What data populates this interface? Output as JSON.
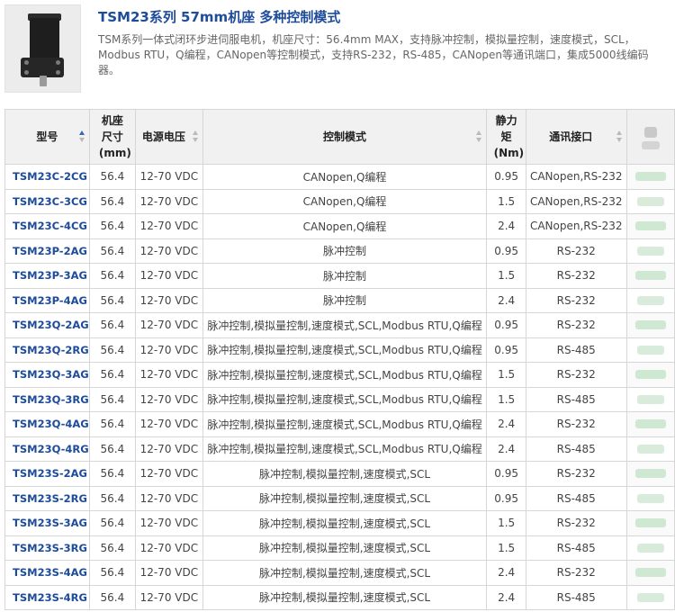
{
  "header": {
    "title": "TSM23系列 57mm机座 多种控制模式",
    "description": "TSM系列一体式闭环步进伺服电机，机座尺寸：56.4mm MAX，支持脉冲控制，模拟量控制，速度模式，SCL，Modbus RTU，Q编程，CANopen等控制模式，支持RS-232，RS-485，CANopen等通讯端口，集成5000线编码器。"
  },
  "table": {
    "columns": [
      {
        "label": "型号",
        "sort": "asc"
      },
      {
        "label": "机座尺寸(mm)",
        "sort": "none"
      },
      {
        "label": "电源电压",
        "sort": "none"
      },
      {
        "label": "控制模式",
        "sort": "none"
      },
      {
        "label": "静力矩(Nm)",
        "sort": "none"
      },
      {
        "label": "通讯接口",
        "sort": "none"
      }
    ],
    "rows": [
      {
        "model": "TSM23C-2CG",
        "frame": "56.4",
        "voltage": "12-70 VDC",
        "control": "CANopen,Q编程",
        "torque": "0.95",
        "comm": "CANopen,RS-232"
      },
      {
        "model": "TSM23C-3CG",
        "frame": "56.4",
        "voltage": "12-70 VDC",
        "control": "CANopen,Q编程",
        "torque": "1.5",
        "comm": "CANopen,RS-232"
      },
      {
        "model": "TSM23C-4CG",
        "frame": "56.4",
        "voltage": "12-70 VDC",
        "control": "CANopen,Q编程",
        "torque": "2.4",
        "comm": "CANopen,RS-232"
      },
      {
        "model": "TSM23P-2AG",
        "frame": "56.4",
        "voltage": "12-70 VDC",
        "control": "脉冲控制",
        "torque": "0.95",
        "comm": "RS-232"
      },
      {
        "model": "TSM23P-3AG",
        "frame": "56.4",
        "voltage": "12-70 VDC",
        "control": "脉冲控制",
        "torque": "1.5",
        "comm": "RS-232"
      },
      {
        "model": "TSM23P-4AG",
        "frame": "56.4",
        "voltage": "12-70 VDC",
        "control": "脉冲控制",
        "torque": "2.4",
        "comm": "RS-232"
      },
      {
        "model": "TSM23Q-2AG",
        "frame": "56.4",
        "voltage": "12-70 VDC",
        "control": "脉冲控制,模拟量控制,速度模式,SCL,Modbus RTU,Q编程",
        "torque": "0.95",
        "comm": "RS-232"
      },
      {
        "model": "TSM23Q-2RG",
        "frame": "56.4",
        "voltage": "12-70 VDC",
        "control": "脉冲控制,模拟量控制,速度模式,SCL,Modbus RTU,Q编程",
        "torque": "0.95",
        "comm": "RS-485"
      },
      {
        "model": "TSM23Q-3AG",
        "frame": "56.4",
        "voltage": "12-70 VDC",
        "control": "脉冲控制,模拟量控制,速度模式,SCL,Modbus RTU,Q编程",
        "torque": "1.5",
        "comm": "RS-232"
      },
      {
        "model": "TSM23Q-3RG",
        "frame": "56.4",
        "voltage": "12-70 VDC",
        "control": "脉冲控制,模拟量控制,速度模式,SCL,Modbus RTU,Q编程",
        "torque": "1.5",
        "comm": "RS-485"
      },
      {
        "model": "TSM23Q-4AG",
        "frame": "56.4",
        "voltage": "12-70 VDC",
        "control": "脉冲控制,模拟量控制,速度模式,SCL,Modbus RTU,Q编程",
        "torque": "2.4",
        "comm": "RS-232"
      },
      {
        "model": "TSM23Q-4RG",
        "frame": "56.4",
        "voltage": "12-70 VDC",
        "control": "脉冲控制,模拟量控制,速度模式,SCL,Modbus RTU,Q编程",
        "torque": "2.4",
        "comm": "RS-485"
      },
      {
        "model": "TSM23S-2AG",
        "frame": "56.4",
        "voltage": "12-70 VDC",
        "control": "脉冲控制,模拟量控制,速度模式,SCL",
        "torque": "0.95",
        "comm": "RS-232"
      },
      {
        "model": "TSM23S-2RG",
        "frame": "56.4",
        "voltage": "12-70 VDC",
        "control": "脉冲控制,模拟量控制,速度模式,SCL",
        "torque": "0.95",
        "comm": "RS-485"
      },
      {
        "model": "TSM23S-3AG",
        "frame": "56.4",
        "voltage": "12-70 VDC",
        "control": "脉冲控制,模拟量控制,速度模式,SCL",
        "torque": "1.5",
        "comm": "RS-232"
      },
      {
        "model": "TSM23S-3RG",
        "frame": "56.4",
        "voltage": "12-70 VDC",
        "control": "脉冲控制,模拟量控制,速度模式,SCL",
        "torque": "1.5",
        "comm": "RS-485"
      },
      {
        "model": "TSM23S-4AG",
        "frame": "56.4",
        "voltage": "12-70 VDC",
        "control": "脉冲控制,模拟量控制,速度模式,SCL",
        "torque": "2.4",
        "comm": "RS-232"
      },
      {
        "model": "TSM23S-4RG",
        "frame": "56.4",
        "voltage": "12-70 VDC",
        "control": "脉冲控制,模拟量控制,速度模式,SCL",
        "torque": "2.4",
        "comm": "RS-485"
      }
    ]
  },
  "colors": {
    "accent": "#1e4c9a",
    "header_bg": "#f1f1f1",
    "border": "#d6d6d6"
  }
}
